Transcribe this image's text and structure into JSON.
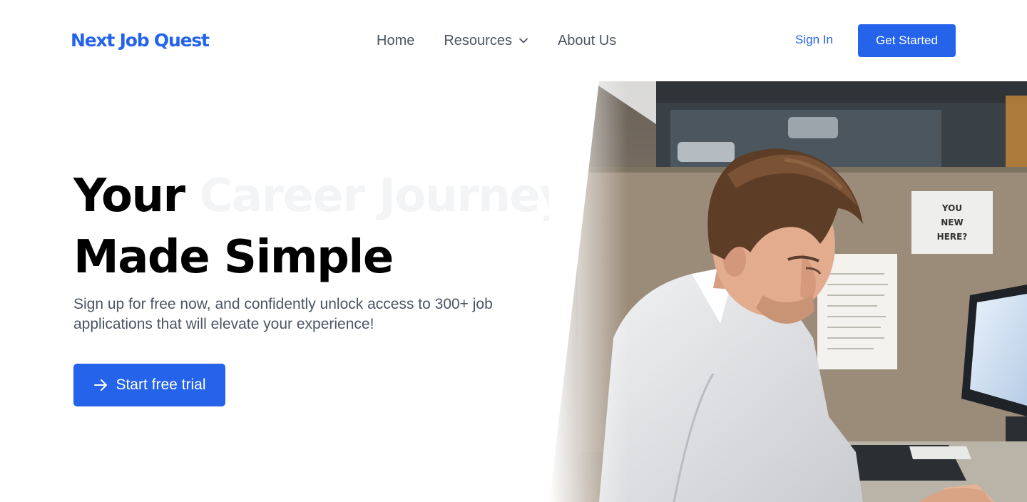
{
  "brand": {
    "name": "Next Job Quest",
    "color": "#2563eb"
  },
  "nav": {
    "home": "Home",
    "resources": "Resources",
    "about": "About Us"
  },
  "header": {
    "sign_in": "Sign In",
    "get_started": "Get Started"
  },
  "hero": {
    "title_line1_dark": "Your",
    "title_line1_faded": "Career Journey",
    "title_line2": "Made Simple",
    "subtitle": "Sign up for free now, and confidently unlock access to 300+ job applications that will elevate your experience!",
    "cta_label": "Start free trial"
  },
  "photo": {
    "note_text": "YOU NEW HERE?"
  },
  "icons": {
    "resources_dropdown": "chevron-down-icon",
    "cta_arrow": "arrow-right-icon",
    "logo": "logo-mark-icon"
  }
}
